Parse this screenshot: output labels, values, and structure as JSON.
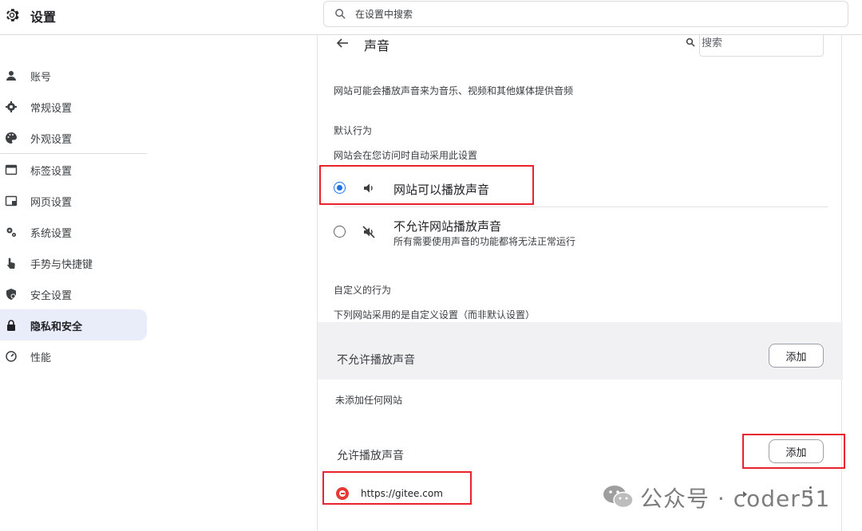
{
  "header": {
    "title": "设置",
    "search_placeholder": "在设置中搜索"
  },
  "sidebar": {
    "items": [
      {
        "label": "账号",
        "icon": "person-icon"
      },
      {
        "label": "常规设置",
        "icon": "gear-icon"
      },
      {
        "label": "外观设置",
        "icon": "palette-icon"
      },
      {
        "label": "标签设置",
        "icon": "tab-icon"
      },
      {
        "label": "网页设置",
        "icon": "webpage-icon"
      },
      {
        "label": "系统设置",
        "icon": "system-icon"
      },
      {
        "label": "手势与快捷键",
        "icon": "hand-icon"
      },
      {
        "label": "安全设置",
        "icon": "shield-icon"
      },
      {
        "label": "隐私和安全",
        "icon": "lock-icon",
        "active": true
      },
      {
        "label": "性能",
        "icon": "gauge-icon"
      }
    ]
  },
  "main": {
    "title": "声音",
    "search_placeholder": "搜索",
    "intro": "网站可能会播放声音来为音乐、视频和其他媒体提供音频",
    "default_behavior": {
      "heading": "默认行为",
      "subheading": "网站会在您访问时自动采用此设置",
      "options": [
        {
          "label": "网站可以播放声音",
          "selected": true
        },
        {
          "label": "不允许网站播放声音",
          "sub": "所有需要使用声音的功能都将无法正常运行",
          "selected": false
        }
      ]
    },
    "custom_behavior": {
      "heading": "自定义的行为",
      "subheading": "下列网站采用的是自定义设置（而非默认设置）"
    },
    "block_group": {
      "title": "不允许播放声音",
      "add_label": "添加",
      "empty": "未添加任何网站"
    },
    "allow_group": {
      "title": "允许播放声音",
      "add_label": "添加",
      "sites": [
        {
          "url": "https://gitee.com"
        }
      ]
    }
  },
  "watermark": {
    "text": "公众号 · coder51"
  },
  "colors": {
    "accent": "#1a73e8",
    "highlight_red": "#e8232f",
    "active_nav_bg": "#e8edf9"
  }
}
